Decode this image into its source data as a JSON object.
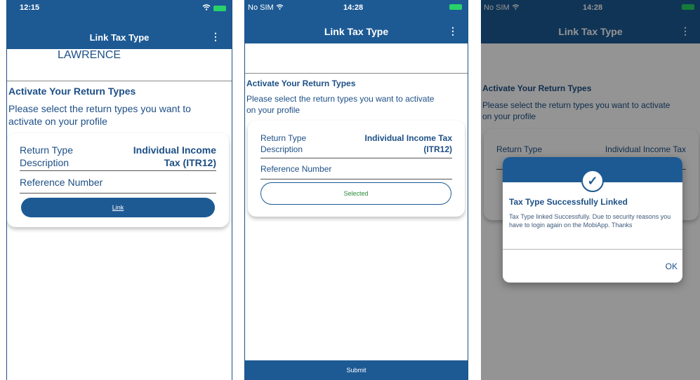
{
  "screen1": {
    "status": {
      "time": "12:15"
    },
    "header": {
      "title": "Link Tax Type"
    },
    "name": "LAWRENCE",
    "section": {
      "title": "Activate Your Return Types",
      "description": "Please select the return types you want to activate on your profile"
    },
    "card": {
      "return_type_label": "Return Type",
      "description_label": "Description",
      "value_line1": "Individual Income",
      "value_line2": "Tax (ITR12)",
      "reference_label": "Reference Number",
      "link_button": "Link"
    }
  },
  "screen2": {
    "status": {
      "carrier": "No SIM",
      "time": "14:28"
    },
    "header": {
      "title": "Link Tax Type"
    },
    "section": {
      "title": "Activate Your Return Types",
      "description": "Please select the return types you want to activate on your profile"
    },
    "card": {
      "return_type_label": "Return Type",
      "description_label": "Description",
      "value_line1": "Individual Income Tax",
      "value_line2": "(ITR12)",
      "reference_label": "Reference Number",
      "selected_button": "Selected"
    },
    "footer": {
      "submit": "Submit"
    }
  },
  "screen3": {
    "status": {
      "carrier": "No SIM",
      "time": "14:28"
    },
    "header": {
      "title": "Link Tax Type"
    },
    "section": {
      "title": "Activate Your Return Types",
      "description": "Please select the return types you want to activate on your profile"
    },
    "card": {
      "return_type_label": "Return Type",
      "value_line1": "Individual Income Tax"
    },
    "dialog": {
      "title": "Tax Type Successfully Linked",
      "message": "Tax Type linked Successfully. Due to security reasons you have to login again on the MobiApp. Thanks",
      "ok_button": "OK"
    }
  },
  "colors": {
    "primary": "#1d5a94",
    "text_blue": "#1d4f86",
    "selected_green": "#2a8a3a",
    "battery_green": "#28d26a"
  }
}
